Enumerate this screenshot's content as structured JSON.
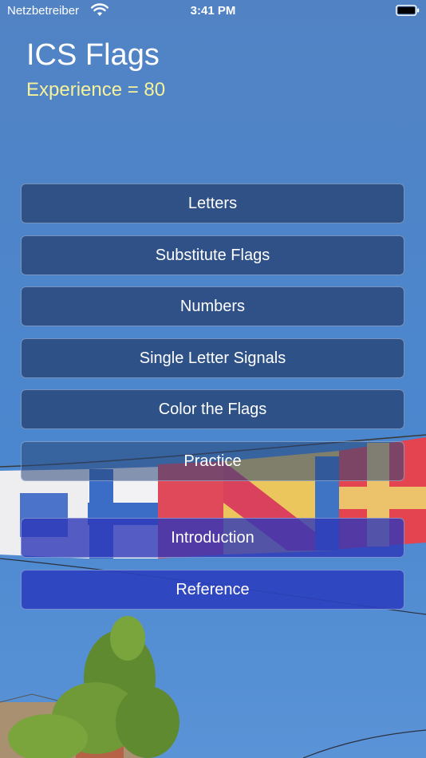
{
  "status_bar": {
    "carrier": "Netzbetreiber",
    "time": "3:41 PM",
    "wifi_icon": "wifi-icon",
    "battery_icon": "battery-icon"
  },
  "header": {
    "title": "ICS Flags",
    "experience": "Experience = 80"
  },
  "menu": {
    "letters": "Letters",
    "substitute_flags": "Substitute Flags",
    "numbers": "Numbers",
    "single_letter_signals": "Single Letter Signals",
    "color_the_flags": "Color the Flags",
    "practice": "Practice",
    "introduction": "Introduction",
    "reference": "Reference"
  },
  "colors": {
    "sky": "#4c86cd",
    "button": "#28467a",
    "experience_text": "#f5f29a",
    "accent_button": "#2d37b9"
  }
}
